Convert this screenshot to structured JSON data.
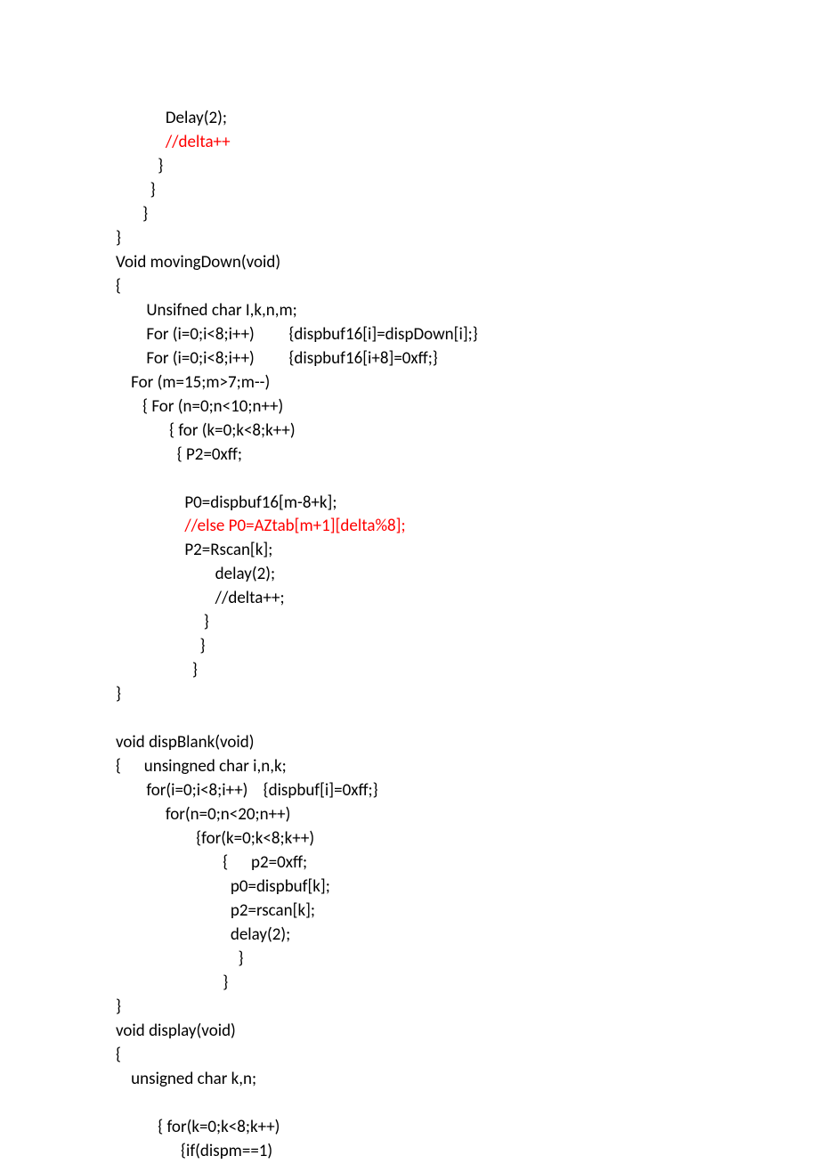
{
  "lines": [
    {
      "text": "             Delay(2);",
      "color": "black"
    },
    {
      "text": "             //delta++",
      "color": "red"
    },
    {
      "text": "           }",
      "color": "black"
    },
    {
      "text": "         }",
      "color": "black"
    },
    {
      "text": "       }",
      "color": "black"
    },
    {
      "text": "}",
      "color": "black"
    },
    {
      "text": "Void movingDown(void)",
      "color": "black"
    },
    {
      "text": "{",
      "color": "black"
    },
    {
      "text": "        Unsifned char I,k,n,m;",
      "color": "black"
    },
    {
      "text": "        For (i=0;i<8;i++)         {dispbuf16[i]=dispDown[i];}",
      "color": "black"
    },
    {
      "text": "        For (i=0;i<8;i++)         {dispbuf16[i+8]=0xff;}",
      "color": "black"
    },
    {
      "text": "    For (m=15;m>7;m--)",
      "color": "black"
    },
    {
      "text": "       { For (n=0;n<10;n++)",
      "color": "black"
    },
    {
      "text": "              { for (k=0;k<8;k++)",
      "color": "black"
    },
    {
      "text": "                { P2=0xff;",
      "color": "black"
    },
    {
      "text": "",
      "color": "black"
    },
    {
      "text": "                  P0=dispbuf16[m-8+k];",
      "color": "black"
    },
    {
      "text": "                  //else P0=AZtab[m+1][delta%8];",
      "color": "red"
    },
    {
      "text": "                  P2=Rscan[k];",
      "color": "black"
    },
    {
      "text": "                          delay(2);",
      "color": "black"
    },
    {
      "text": "                          //delta++;",
      "color": "black"
    },
    {
      "text": "                       }",
      "color": "black"
    },
    {
      "text": "                      }",
      "color": "black"
    },
    {
      "text": "                    }",
      "color": "black"
    },
    {
      "text": "}",
      "color": "black"
    },
    {
      "text": "",
      "color": "black"
    },
    {
      "text": "void dispBlank(void)",
      "color": "black"
    },
    {
      "text": "{      unsingned char i,n,k;",
      "color": "black"
    },
    {
      "text": "        for(i=0;i<8;i++)    {dispbuf[i]=0xff;}",
      "color": "black"
    },
    {
      "text": "             for(n=0;n<20;n++)",
      "color": "black"
    },
    {
      "text": "                     {for(k=0;k<8;k++)",
      "color": "black"
    },
    {
      "text": "                            {      p2=0xff;",
      "color": "black"
    },
    {
      "text": "                              p0=dispbuf[k];",
      "color": "black"
    },
    {
      "text": "                              p2=rscan[k];",
      "color": "black"
    },
    {
      "text": "                              delay(2);",
      "color": "black"
    },
    {
      "text": "                                }",
      "color": "black"
    },
    {
      "text": "                            }",
      "color": "black"
    },
    {
      "text": "}",
      "color": "black"
    },
    {
      "text": "void display(void)",
      "color": "black"
    },
    {
      "text": "{",
      "color": "black"
    },
    {
      "text": "    unsigned char k,n;",
      "color": "black"
    },
    {
      "text": "       ",
      "color": "black"
    },
    {
      "text": "           { for(k=0;k<8;k++)",
      "color": "black"
    },
    {
      "text": "                 {if(dispm==1)",
      "color": "black"
    }
  ]
}
